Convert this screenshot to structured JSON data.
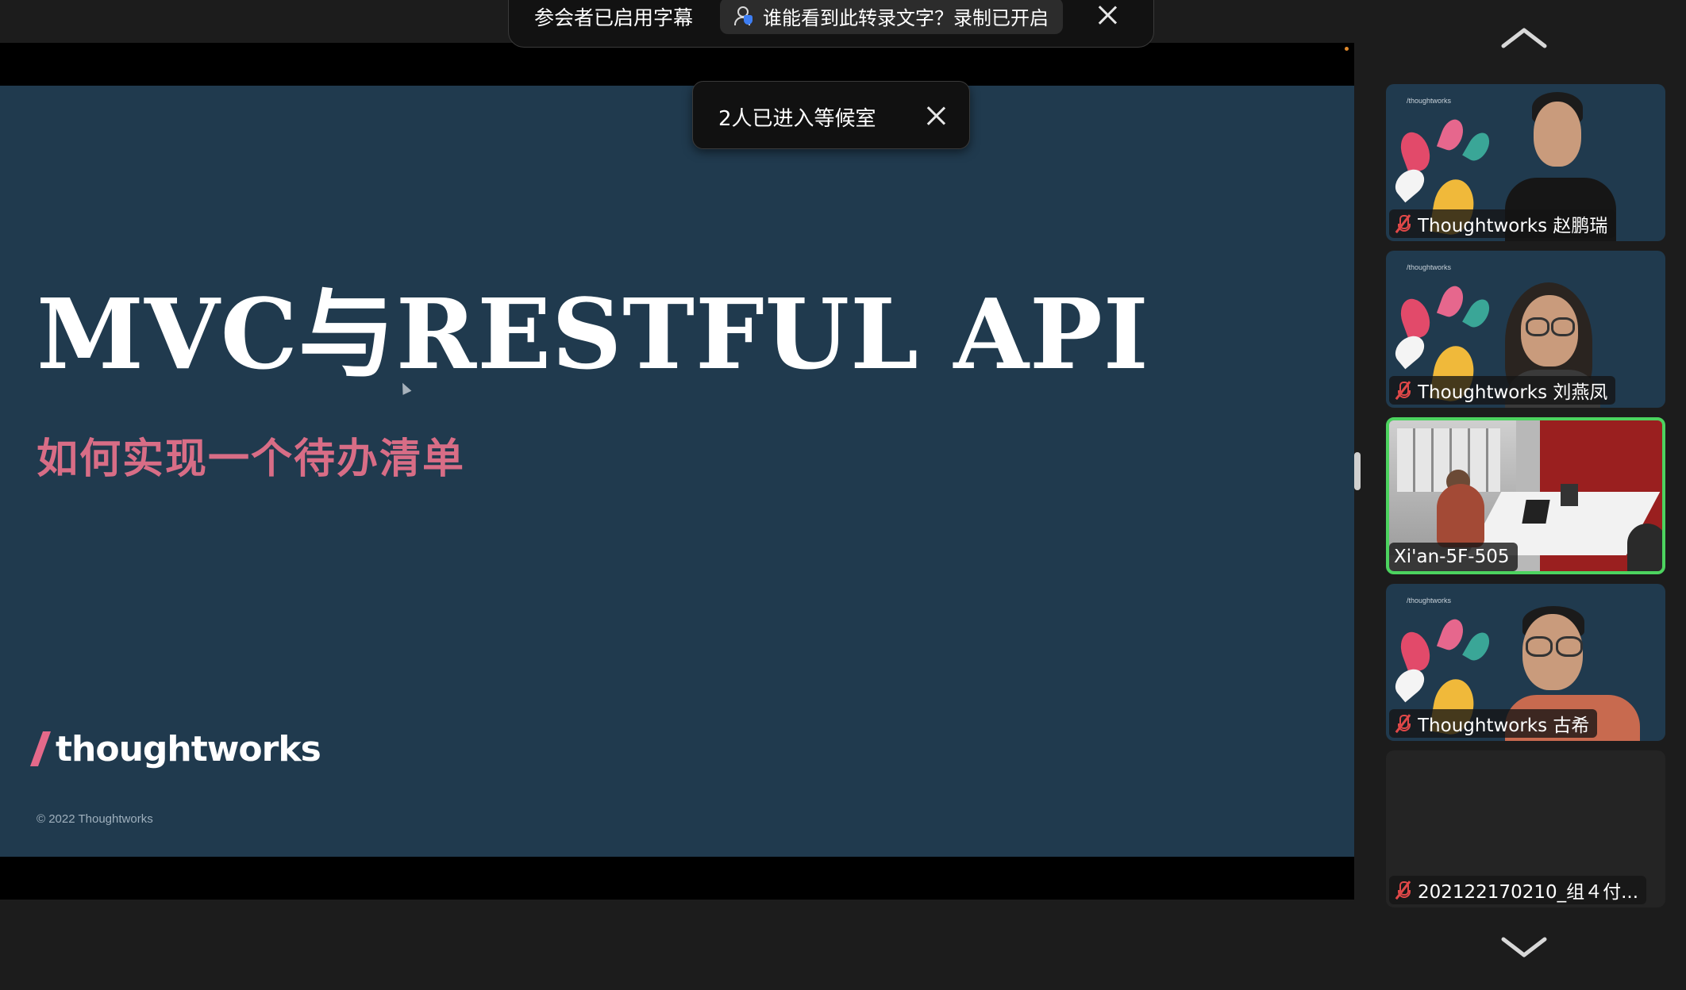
{
  "caption_banner": {
    "status": "参会者已启用字幕",
    "transcript_notice": "谁能看到此转录文字？录制已开启"
  },
  "waiting_room_toast": {
    "message": "2人已进入等候室"
  },
  "slide": {
    "title": "MVC与RESTFUL API",
    "subtitle": "如何实现一个待办清单",
    "logo": "thoughtworks",
    "copyright": "© 2022 Thoughtworks",
    "background_color": "#203a4e",
    "title_color": "#ffffff",
    "subtitle_color": "#d86d86"
  },
  "participants": [
    {
      "name": "Thoughtworks 赵鹏瑞",
      "muted": true,
      "bg_label": "/thoughtworks"
    },
    {
      "name": "Thoughtworks 刘燕凤",
      "muted": true,
      "bg_label": "/thoughtworks"
    },
    {
      "name": "Xi'an-5F-505",
      "muted": false,
      "active_speaker": true
    },
    {
      "name": "Thoughtworks 古希",
      "muted": true,
      "bg_label": "/thoughtworks"
    },
    {
      "name": "202122170210_组４付...",
      "muted": true,
      "video_off": true
    }
  ],
  "colors": {
    "active_speaker_border": "#4cd35f",
    "muted_icon": "#e04848",
    "accent_blue": "#3d7ef4"
  },
  "icons": {
    "scroll_up": "chevron-up-icon",
    "scroll_down": "chevron-down-icon",
    "close": "close-icon",
    "muted_mic": "mic-muted-icon",
    "transcript": "person-shield-icon"
  }
}
